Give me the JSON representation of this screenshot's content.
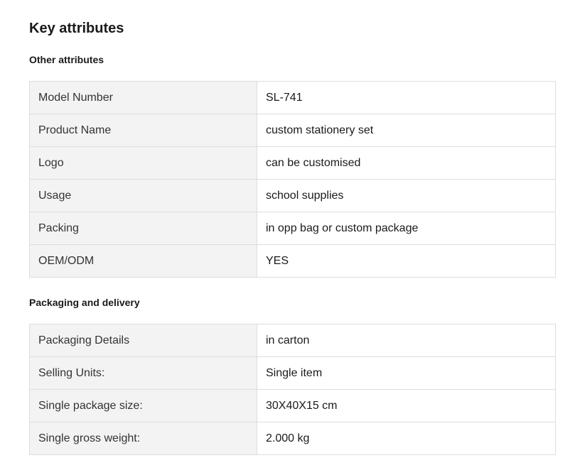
{
  "title": "Key attributes",
  "sections": [
    {
      "title": "Other attributes",
      "rows": [
        {
          "label": "Model Number",
          "value": "SL-741"
        },
        {
          "label": "Product Name",
          "value": "custom stationery set"
        },
        {
          "label": "Logo",
          "value": "can be customised"
        },
        {
          "label": "Usage",
          "value": "school supplies"
        },
        {
          "label": "Packing",
          "value": "in opp bag or custom package"
        },
        {
          "label": "OEM/ODM",
          "value": "YES"
        }
      ]
    },
    {
      "title": "Packaging and delivery",
      "rows": [
        {
          "label": "Packaging Details",
          "value": "in carton"
        },
        {
          "label": "Selling Units:",
          "value": "Single item"
        },
        {
          "label": "Single package size:",
          "value": "30X40X15 cm"
        },
        {
          "label": "Single gross weight:",
          "value": "2.000 kg"
        }
      ]
    }
  ]
}
